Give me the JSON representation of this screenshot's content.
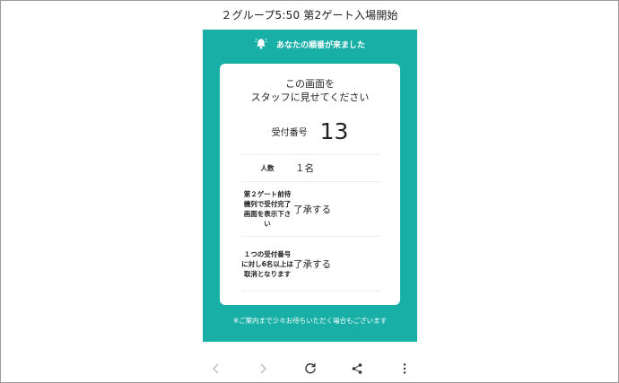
{
  "header": {
    "title": "２グループ5:50 第2ゲート入場開始"
  },
  "notice": {
    "icon": "bell-icon",
    "text": "あなたの順番が来ました"
  },
  "card": {
    "title_line1": "この画面を",
    "title_line2": "スタッフに見せてください",
    "receipt_label": "受付番号",
    "receipt_number": "13",
    "rows": [
      {
        "label": "人数",
        "value": "１名"
      },
      {
        "label": "第２ゲート前待機列で受付完了画面を表示下さい",
        "value": "了承する"
      },
      {
        "label": "１つの受付番号に対し6名以上は取消となります",
        "value": "了承する"
      }
    ]
  },
  "footer_note": "※ご案内まで少々お待ちいただく場合もございます",
  "browser_nav": {
    "icons": [
      "back-icon",
      "forward-icon",
      "reload-icon",
      "share-icon",
      "more-icon"
    ]
  },
  "colors": {
    "panel": "#18b0a6",
    "card": "#ffffff",
    "nav_icon_disabled": "#bdbdbd",
    "nav_icon": "#333333"
  }
}
